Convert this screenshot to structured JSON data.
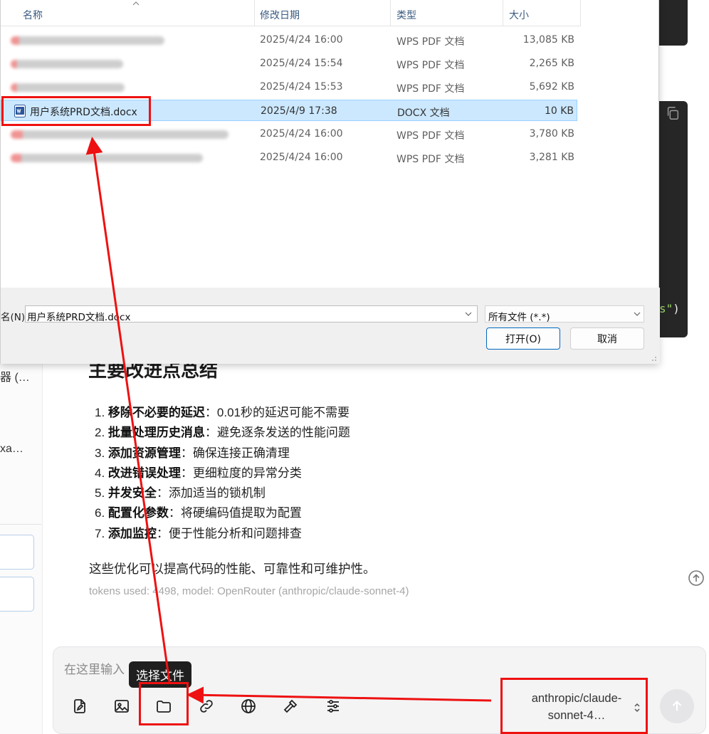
{
  "file_dialog": {
    "columns": {
      "name": "名称",
      "date": "修改日期",
      "type": "类型",
      "size": "大小"
    },
    "files": [
      {
        "name": "",
        "date": "2025/4/24 16:00",
        "type": "WPS PDF 文档",
        "size": "13,085 KB",
        "blurred": true
      },
      {
        "name": "",
        "date": "2025/4/24 15:54",
        "type": "WPS PDF 文档",
        "size": "2,265 KB",
        "blurred": true
      },
      {
        "name": "",
        "date": "2025/4/24 15:53",
        "type": "WPS PDF 文档",
        "size": "5,692 KB",
        "blurred": true
      },
      {
        "name": "用户系统PRD文档.docx",
        "date": "2025/4/9 17:38",
        "type": "DOCX 文档",
        "size": "10 KB",
        "selected": true
      },
      {
        "name": "",
        "date": "2025/4/24 16:00",
        "type": "WPS PDF 文档",
        "size": "3,780 KB",
        "blurred": true
      },
      {
        "name": "",
        "date": "2025/4/24 16:00",
        "type": "WPS PDF 文档",
        "size": "3,281 KB",
        "blurred": true
      }
    ],
    "filename_label": "名(N):",
    "filename_value": "用户系统PRD文档.docx",
    "filter_value": "所有文件 (*.*)",
    "open_button": "打开(O)",
    "cancel_button": "取消"
  },
  "sidebar": {
    "fragments": [
      "器 (…",
      "xa…"
    ]
  },
  "code": {
    "snippet_string": "s\"",
    "snippet_paren": ")"
  },
  "message": {
    "heading": "主要改进点总结",
    "items": [
      {
        "num": "1.",
        "bold": "移除不必要的延迟",
        "text": "：0.01秒的延迟可能不需要"
      },
      {
        "num": "2.",
        "bold": "批量处理历史消息",
        "text": "：避免逐条发送的性能问题"
      },
      {
        "num": "3.",
        "bold": "添加资源管理",
        "text": "：确保连接正确清理"
      },
      {
        "num": "4.",
        "bold": "改进错误处理",
        "text": "：更细粒度的异常分类"
      },
      {
        "num": "5.",
        "bold": "并发安全",
        "text": "：添加适当的锁机制"
      },
      {
        "num": "6.",
        "bold": "配置化参数",
        "text": "：将硬编码值提取为配置"
      },
      {
        "num": "7.",
        "bold": "添加监控",
        "text": "：便于性能分析和问题排查"
      }
    ],
    "conclusion": "这些优化可以提高代码的性能、可靠性和可维护性。",
    "tokens": "tokens used: 4498, model: OpenRouter (anthropic/claude-sonnet-4)"
  },
  "composer": {
    "placeholder": "在这里输入",
    "tooltip": "选择文件",
    "model_label": "anthropic/claude-sonnet-4…",
    "tools": [
      "file-edit-icon",
      "image-icon",
      "folder-icon",
      "link-icon",
      "globe-icon",
      "hammer-icon",
      "sliders-icon"
    ]
  },
  "colors": {
    "annotation": "#ee1111",
    "selected_row": "#cce8ff",
    "primary_border": "#0067c0",
    "code_bg": "#262626"
  }
}
